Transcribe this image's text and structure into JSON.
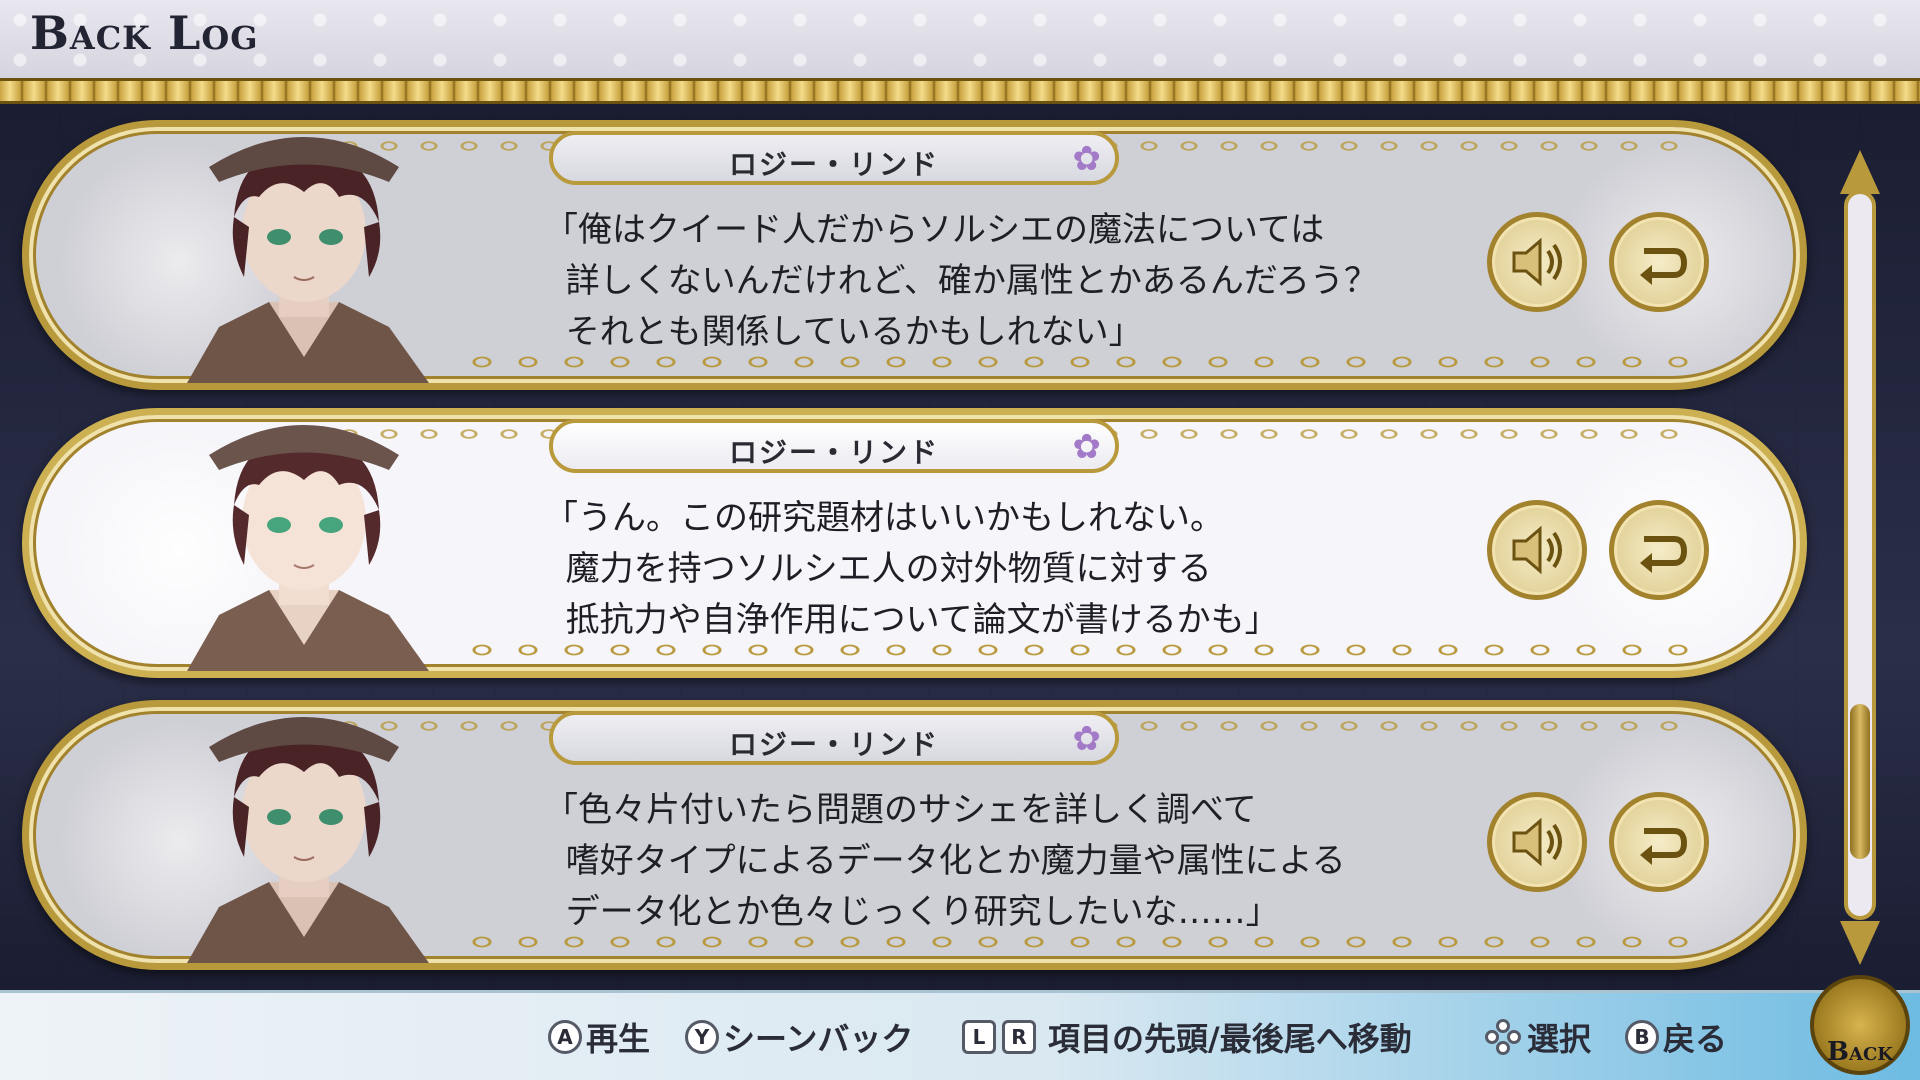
{
  "header": {
    "title": "Back Log"
  },
  "entries": [
    {
      "speaker": "ロジー・リンド",
      "lines": "「俺はクイード人だからソルシエの魔法については\n  詳しくないんだけれど、確か属性とかあるんだろう？\n  それとも関係しているかもしれない」",
      "active": false
    },
    {
      "speaker": "ロジー・リンド",
      "lines": "「うん。この研究題材はいいかもしれない。\n  魔力を持つソルシエ人の対外物質に対する\n  抵抗力や自浄作用について論文が書けるかも」",
      "active": true
    },
    {
      "speaker": "ロジー・リンド",
      "lines": "「色々片付いたら問題のサシェを詳しく調べて\n  嗜好タイプによるデータ化とか魔力量や属性による\n  データ化とか色々じっくり研究したいな……」",
      "active": false
    }
  ],
  "footer": {
    "hint_a_key": "A",
    "hint_a_label": "再生",
    "hint_y_key": "Y",
    "hint_y_label": "シーンバック",
    "hint_l_key": "L",
    "hint_r_key": "R",
    "hint_lr_label": "項目の先頭/最後尾へ移動",
    "hint_dpad_label": "選択",
    "hint_b_key": "B",
    "hint_b_label": "戻る",
    "back_button_label": "Back"
  },
  "scrollbar": {
    "position_fraction": 0.9
  },
  "colors": {
    "gold": "#b8993c",
    "rose": "#a37ac8",
    "active_entry_bg": "#f6f5f9",
    "inactive_entry_bg": "#cfcfd6"
  },
  "icons": {
    "voice": "speaker-icon",
    "jump": "return-arrow-icon",
    "name_decoration": "rose-icon"
  }
}
